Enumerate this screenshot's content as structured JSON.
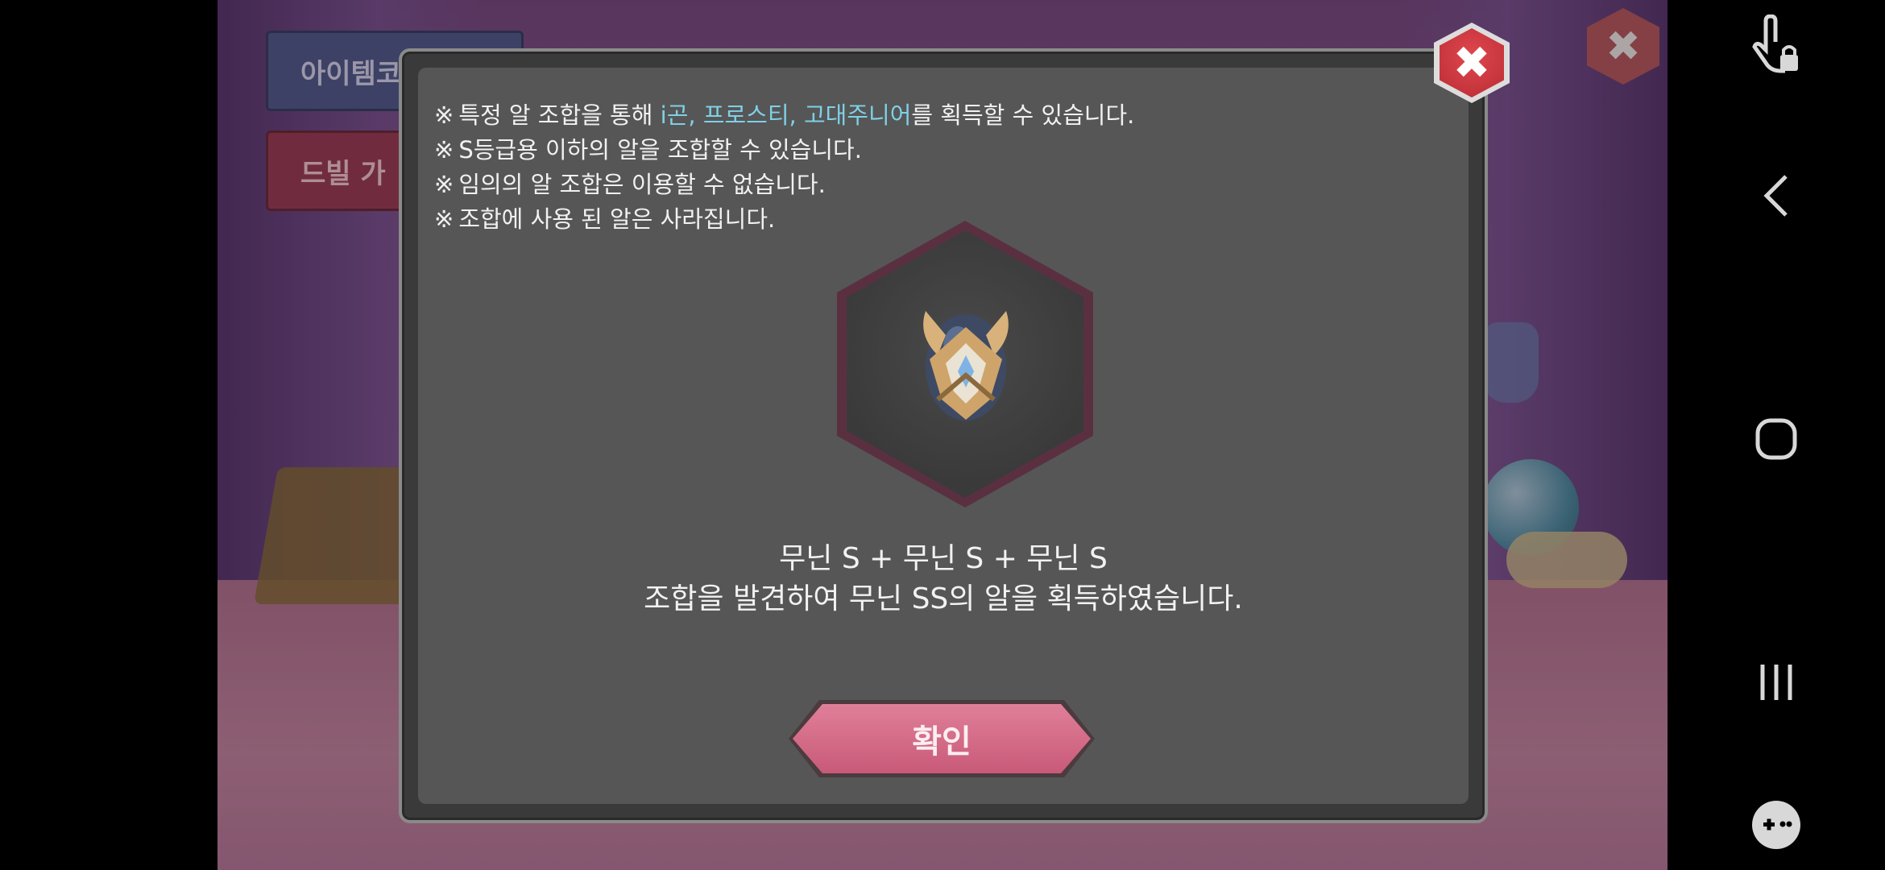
{
  "background": {
    "item_code_button": "아이템코",
    "devil_button": "드빌 가"
  },
  "dialog": {
    "notes": [
      {
        "prefix": "※",
        "before": "특정 알 조합을 통해 ",
        "highlight": "i곤, 프로스티, 고대주니어",
        "after": "를 획득할 수 있습니다."
      },
      {
        "prefix": "※",
        "before": "S등급용 이하의 알을 조합할 수 있습니다.",
        "highlight": "",
        "after": ""
      },
      {
        "prefix": "※",
        "before": "임의의 알 조합은 이용할 수 없습니다.",
        "highlight": "",
        "after": ""
      },
      {
        "prefix": "※",
        "before": "조합에 사용 된 알은 사라집니다.",
        "highlight": "",
        "after": ""
      }
    ],
    "result_line1": "무닌 S + 무닌 S + 무닌 S",
    "result_line2": "조합을 발견하여 무닌 SS의 알을 획득하였습니다.",
    "confirm_label": "확인",
    "close_icon": "close-icon",
    "egg_icon": "muninn-ss-egg-icon"
  },
  "navbar": {
    "icons": [
      "touch-lock-icon",
      "back-icon",
      "home-icon",
      "recents-icon",
      "game-tools-icon"
    ]
  },
  "colors": {
    "highlight": "#7fd0e6",
    "confirm": "#d46b88",
    "close": "#c9363e",
    "dialog_bg": "#565656"
  }
}
